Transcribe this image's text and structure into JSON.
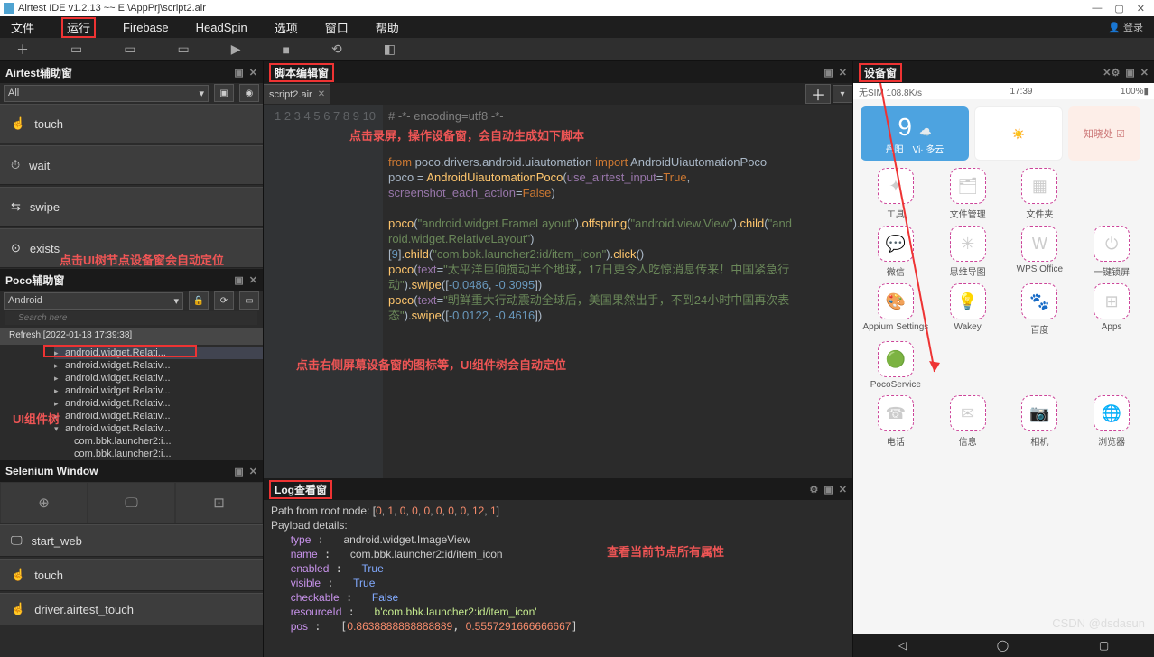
{
  "title": "Airtest IDE v1.2.13 ~~ E:\\AppPrj\\script2.air",
  "menu": [
    "文件",
    "运行",
    "Firebase",
    "HeadSpin",
    "选项",
    "窗口",
    "帮助"
  ],
  "login": "👤 登录",
  "toolbar_icons": [
    "＋",
    "▭",
    "▭",
    "▭",
    "▶",
    "■",
    "⟲",
    "◧"
  ],
  "airtest": {
    "title": "Airtest辅助窗",
    "filter": "All",
    "ops": [
      "touch",
      "wait",
      "swipe",
      "exists"
    ]
  },
  "poco": {
    "title": "Poco辅助窗",
    "mode": "Android",
    "search_ph": "Search here",
    "refresh": "Refresh:[2022-01-18 17:39:38]",
    "tree": [
      "android.widget.Relati...",
      "android.widget.Relativ...",
      "android.widget.Relativ...",
      "android.widget.Relativ...",
      "android.widget.Relativ...",
      "android.widget.Relativ...",
      "android.widget.Relativ...",
      "com.bbk.launcher2:i...",
      "com.bbk.launcher2:i..."
    ]
  },
  "selenium": {
    "title": "Selenium Window",
    "ops": [
      "start_web",
      "touch",
      "driver.airtest_touch"
    ]
  },
  "editor": {
    "title": "脚本编辑窗",
    "tab": "script2.air",
    "annot1": "点击录屏，操作设备窗，会自动生成如下脚本",
    "annot2": "点击UI树节点设备窗会自动定位",
    "annot3": "点击右侧屏幕设备窗的图标等，UI组件树会自动定位",
    "annot4": "UI组件树"
  },
  "code_lines": [
    "1",
    "2",
    "3",
    "4",
    "5",
    "6",
    "7",
    "8",
    "9",
    "",
    "10"
  ],
  "log": {
    "title": "Log查看窗",
    "annot": "查看当前节点所有属性",
    "path": "Path from root node: [0, 1, 0, 0, 0, 0, 0, 0, 12, 1]",
    "details": "Payload details:",
    "type": "android.widget.ImageView",
    "name": "com.bbk.launcher2:id/item_icon",
    "enabled": "True",
    "visible": "True",
    "checkable": "False",
    "resourceId": "b'com.bbk.launcher2:id/item_icon'",
    "pos": "[0.8638888888888889, 0.5557291666666667]"
  },
  "device": {
    "title": "设备窗",
    "status_left": "无SIM 108.8K/s",
    "status_time": "17:39",
    "status_right": "100%▮",
    "big_num": "9",
    "big_sub1": "丹阳",
    "big_sub2": "Vi· 多云",
    "big_sub3": "知晓处 ☑",
    "apps": [
      {
        "lb": "工具",
        "g": "✦"
      },
      {
        "lb": "文件管理",
        "g": "🗂"
      },
      {
        "lb": "文件夹",
        "g": "▦"
      },
      {
        "lb": "",
        "g": ""
      },
      {
        "lb": "微信",
        "g": "💬"
      },
      {
        "lb": "思维导图",
        "g": "✳"
      },
      {
        "lb": "WPS Office",
        "g": "W"
      },
      {
        "lb": "一键锁屏",
        "g": "⏻"
      },
      {
        "lb": "Appium Settings",
        "g": "🎨"
      },
      {
        "lb": "Wakey",
        "g": "💡"
      },
      {
        "lb": "百度",
        "g": "🐾"
      },
      {
        "lb": "Apps",
        "g": "⊞"
      },
      {
        "lb": "PocoService",
        "g": "🟢"
      },
      {
        "lb": "",
        "g": ""
      },
      {
        "lb": "",
        "g": ""
      },
      {
        "lb": "",
        "g": ""
      },
      {
        "lb": "电话",
        "g": "☎"
      },
      {
        "lb": "信息",
        "g": "✉"
      },
      {
        "lb": "相机",
        "g": "📷"
      },
      {
        "lb": "浏览器",
        "g": "🌐"
      }
    ]
  },
  "watermark": "CSDN @dsdasun"
}
